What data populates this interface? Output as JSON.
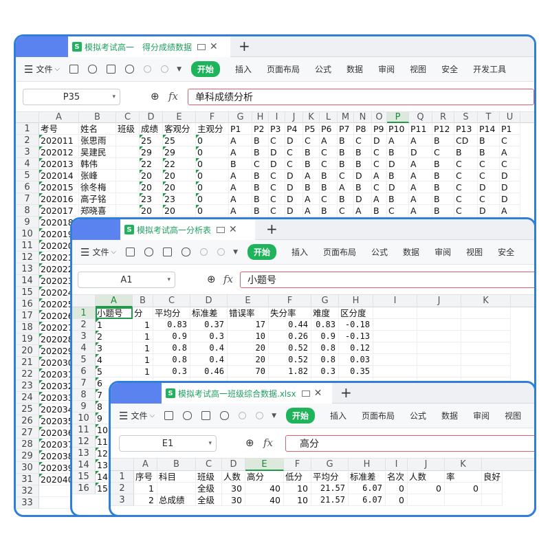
{
  "windows": [
    {
      "id": "w1",
      "tab_title": "模拟考试高一　得分成绩数据",
      "name_box": "P35",
      "formula": "单科成绩分析",
      "columns": [
        "A",
        "B",
        "C",
        "D",
        "E",
        "F",
        "G",
        "H",
        "I",
        "J",
        "K",
        "L",
        "M",
        "N",
        "O",
        "P",
        "Q",
        "R",
        "S",
        "T",
        "U"
      ],
      "selected_column": "P",
      "row_numbers": [
        "1",
        "2",
        "3",
        "4",
        "5",
        "6",
        "7",
        "8",
        "9",
        "10",
        "11",
        "12",
        "13",
        "14",
        "15",
        "16",
        "17",
        "18",
        "19",
        "20",
        "21",
        "22",
        "23",
        "24",
        "25",
        "26",
        "27",
        "28",
        "29",
        "30",
        "31",
        "32",
        "33"
      ],
      "header_row": [
        "考号",
        "姓名",
        "班级",
        "成绩",
        "客观分",
        "主观分",
        "P1",
        "P2",
        "P3",
        "P4",
        "P5",
        "P6",
        "P7",
        "P8",
        "P9",
        "P10",
        "P11",
        "P12",
        "P13",
        "P14",
        "P1"
      ],
      "rows": [
        [
          "202011",
          "张思雨",
          "",
          "25",
          "25",
          "0",
          "A",
          "B",
          "C",
          "D",
          "C",
          "A",
          "B",
          "C",
          "D",
          "A",
          "A",
          "B",
          "CD",
          "B",
          "C"
        ],
        [
          "202012",
          "吴建民",
          "",
          "29",
          "29",
          "0",
          "A",
          "B",
          "D",
          "C",
          "B",
          "C",
          "B",
          "B",
          "C",
          "B",
          "D",
          "C",
          "B",
          "B",
          "A"
        ],
        [
          "202013",
          "韩伟",
          "",
          "22",
          "22",
          "0",
          "B",
          "C",
          "D",
          "C",
          "B",
          "C",
          "B",
          "B",
          "C",
          "D",
          "A",
          "B",
          "C",
          "C",
          "C"
        ],
        [
          "202014",
          "张峰",
          "",
          "20",
          "20",
          "0",
          "A",
          "B",
          "C",
          "D",
          "A",
          "B",
          "C",
          "D",
          "A",
          "B",
          "A",
          "B",
          "C",
          "C",
          "D"
        ],
        [
          "202015",
          "徐冬梅",
          "",
          "20",
          "20",
          "0",
          "A",
          "B",
          "C",
          "D",
          "B",
          "B",
          "A",
          "B",
          "C",
          "D",
          "A",
          "B",
          "C",
          "D",
          "D"
        ],
        [
          "202016",
          "高子铭",
          "",
          "23",
          "23",
          "0",
          "A",
          "B",
          "C",
          "D",
          "A",
          "C",
          "B",
          "D",
          "A",
          "B",
          "A",
          "B",
          "C",
          "C",
          "D"
        ],
        [
          "202017",
          "郑晓喜",
          "",
          "20",
          "20",
          "0",
          "A",
          "B",
          "C",
          "D",
          "A",
          "B",
          "C",
          "A",
          "B",
          "C",
          "A",
          "B",
          "C",
          "D",
          "A"
        ],
        [
          "202018"
        ],
        [
          "202019"
        ],
        [
          "202020"
        ],
        [
          "202021"
        ],
        [
          "202022"
        ],
        [
          "202023"
        ],
        [
          "202024"
        ],
        [
          "202025"
        ],
        [
          "202026"
        ],
        [
          "202027"
        ],
        [
          "202028"
        ],
        [
          "202029"
        ],
        [
          "202030"
        ],
        [
          "202031"
        ],
        [
          "202032"
        ],
        [
          "202033"
        ],
        [
          "202034"
        ],
        [
          "202035"
        ],
        [
          "202036"
        ],
        [
          "202037"
        ],
        [
          "202038"
        ],
        [
          "202039"
        ],
        [
          "202040"
        ]
      ]
    },
    {
      "id": "w2",
      "tab_title": "模拟考试高一分析表",
      "name_box": "A1",
      "formula": "小题号",
      "columns": [
        "A",
        "B",
        "C",
        "D",
        "E",
        "F",
        "G",
        "H",
        "I",
        "J",
        "K"
      ],
      "selected_column": "A",
      "row_numbers": [
        "1",
        "2",
        "3",
        "4",
        "5",
        "6",
        "7",
        "8",
        "9",
        "10",
        "11",
        "12",
        "13",
        "14",
        "15",
        "16"
      ],
      "header_row": [
        "小题号",
        "分",
        "平均分",
        "标准差",
        "错误率",
        "失分率",
        "难度",
        "区分度"
      ],
      "rows": [
        [
          "1",
          "1",
          "0.83",
          "0.37",
          "17",
          "0.44",
          "0.83",
          "-0.18"
        ],
        [
          "2",
          "1",
          "0.9",
          "0.3",
          "10",
          "0.26",
          "0.9",
          "-0.13"
        ],
        [
          "3",
          "1",
          "0.8",
          "0.4",
          "20",
          "0.52",
          "0.8",
          "0.12"
        ],
        [
          "4",
          "1",
          "0.8",
          "0.4",
          "20",
          "0.52",
          "0.8",
          "0.03"
        ],
        [
          "5",
          "1",
          "0.3",
          "0.46",
          "70",
          "1.82",
          "0.3",
          "0.35"
        ],
        [
          "6"
        ],
        [
          "7"
        ],
        [
          "8"
        ],
        [
          "9"
        ],
        [
          "10"
        ],
        [
          "11"
        ],
        [
          "12"
        ],
        [
          "13"
        ],
        [
          "14"
        ],
        [
          "15"
        ],
        [
          "16"
        ]
      ]
    },
    {
      "id": "w3",
      "tab_title": "模拟考试高一班级综合数据.xlsx",
      "name_box": "E1",
      "formula": "高分",
      "columns": [
        "A",
        "B",
        "C",
        "D",
        "E",
        "F",
        "G",
        "H",
        "I",
        "J",
        "K"
      ],
      "selected_column": "E",
      "row_numbers": [
        "1",
        "2",
        "3"
      ],
      "header_row": [
        "序号",
        "科目",
        "班级",
        "人数",
        "高分",
        "低分",
        "平均分",
        "标准差",
        "名次",
        "人数",
        "率",
        "良好"
      ],
      "rows": [
        [
          "1",
          "",
          "全级",
          "30",
          "40",
          "10",
          "21.57",
          "6.07",
          "0",
          "0",
          "0"
        ],
        [
          "2",
          "总成绩",
          "全级",
          "30",
          "40",
          "10",
          "21.57",
          "6.07",
          "0"
        ]
      ]
    }
  ],
  "toolbar": {
    "file": "文件",
    "start": "开始",
    "insert": "插入",
    "page_layout": "页面布局",
    "formula": "公式",
    "data": "数据",
    "review": "审阅",
    "view": "视图",
    "security": "安全",
    "devtools": "开发工具"
  },
  "fx_label": "fx"
}
